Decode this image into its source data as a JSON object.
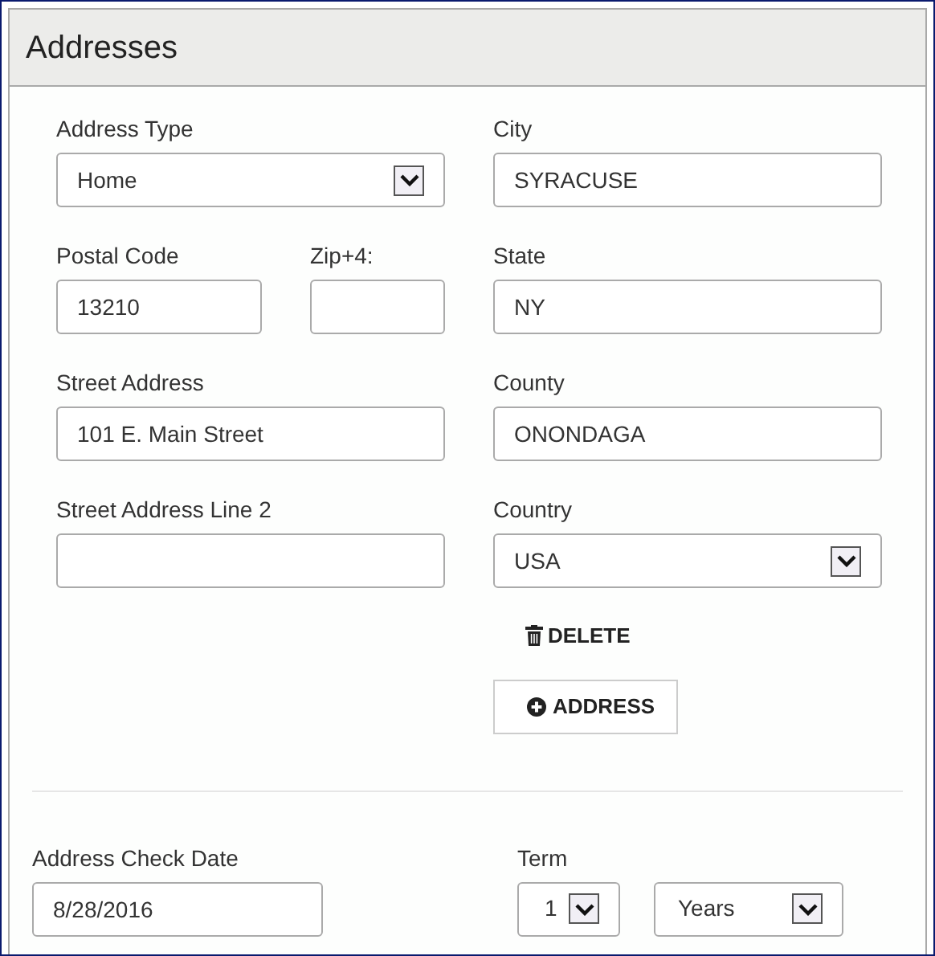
{
  "title": "Addresses",
  "address_type": {
    "label": "Address Type",
    "value": "Home"
  },
  "city": {
    "label": "City",
    "value": "SYRACUSE"
  },
  "postal_code": {
    "label": "Postal Code",
    "value": "13210"
  },
  "zip4": {
    "label": "Zip+4:"
  },
  "state": {
    "label": "State",
    "value": "NY"
  },
  "street": {
    "label": "Street Address",
    "value": "101 E. Main Street"
  },
  "county": {
    "label": "County",
    "value": "ONONDAGA"
  },
  "street2": {
    "label": "Street Address Line 2"
  },
  "country": {
    "label": "Country",
    "value": "USA"
  },
  "delete_button": "DELETE",
  "add_address_button": "ADDRESS",
  "check_date": {
    "label": "Address Check Date",
    "value": "8/28/2016"
  },
  "term": {
    "label": "Term",
    "number": "1",
    "unit": "Years"
  }
}
